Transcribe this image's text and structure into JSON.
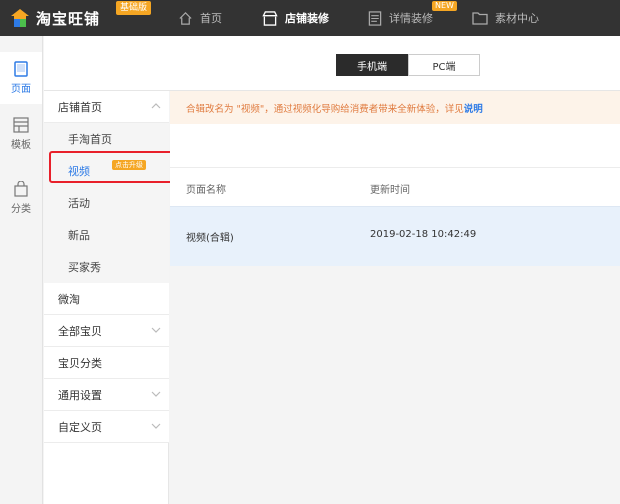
{
  "app": {
    "name": "淘宝旺铺",
    "plan_badge": "基础版"
  },
  "topnav": [
    {
      "label": "首页",
      "icon": "home-icon",
      "active": false
    },
    {
      "label": "店铺装修",
      "icon": "store-icon",
      "active": true
    },
    {
      "label": "详情装修",
      "icon": "document-icon",
      "active": false,
      "badge": "NEW"
    },
    {
      "label": "素材中心",
      "icon": "folder-icon",
      "active": false
    }
  ],
  "leftrail": [
    {
      "label": "页面",
      "icon": "page-icon",
      "active": true
    },
    {
      "label": "模板",
      "icon": "template-icon",
      "active": false
    },
    {
      "label": "分类",
      "icon": "bag-icon",
      "active": false
    }
  ],
  "device_toggle": {
    "mobile": "手机端",
    "pc": "PC端",
    "selected": "mobile"
  },
  "submenu": {
    "groups": [
      {
        "label": "店铺首页",
        "expanded": true,
        "items": [
          {
            "label": "手淘首页"
          },
          {
            "label": "视频",
            "badge": "点击升级",
            "active": true
          },
          {
            "label": "活动"
          },
          {
            "label": "新品"
          },
          {
            "label": "买家秀"
          }
        ]
      },
      {
        "label": "微淘"
      },
      {
        "label": "全部宝贝",
        "collapsible": true
      },
      {
        "label": "宝贝分类"
      },
      {
        "label": "通用设置",
        "collapsible": true
      },
      {
        "label": "自定义页",
        "collapsible": true
      }
    ]
  },
  "notice": {
    "text": "合辑改名为 \"视频\"，通过视频化导购给消费者带来全新体验，详见",
    "link": "说明"
  },
  "table": {
    "columns": [
      "页面名称",
      "更新时间"
    ],
    "rows": [
      {
        "name": "视频(合辑)",
        "updated": "2019-02-18 10:42:49"
      }
    ]
  },
  "colors": {
    "topbar": "#333333",
    "accent": "#2e7be6",
    "badge": "#f5a623",
    "highlight": "#e8202a"
  }
}
